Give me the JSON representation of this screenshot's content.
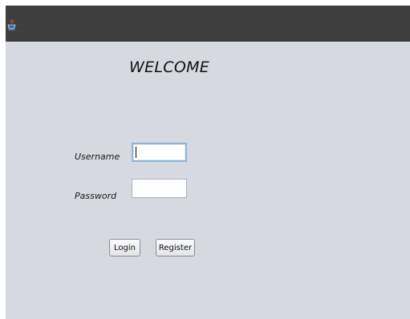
{
  "window": {
    "icon": "java-cup-icon"
  },
  "welcome": {
    "title": "WELCOME"
  },
  "form": {
    "username_label": "Username",
    "username_value": "",
    "password_label": "Password",
    "password_value": ""
  },
  "buttons": {
    "login_label": "Login",
    "register_label": "Register"
  },
  "colors": {
    "titlebar": "#3c3c3c",
    "background": "#d6d9df",
    "focus_border": "#8fb4d9"
  }
}
